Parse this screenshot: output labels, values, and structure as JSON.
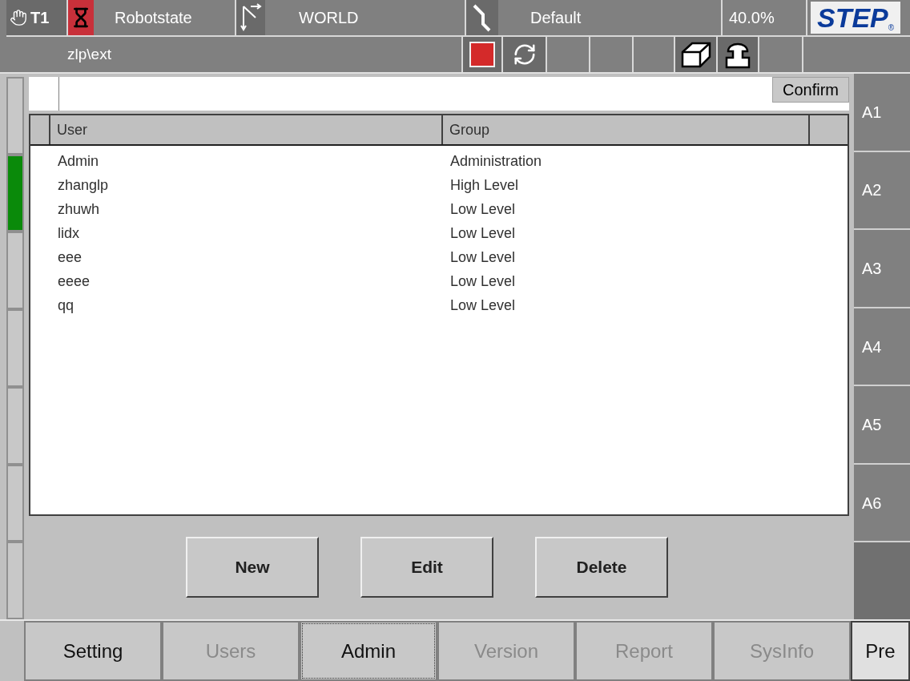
{
  "status_bar": {
    "mode": "T1",
    "robot_state": "Robotstate",
    "coordinate": "WORLD",
    "tool": "Default",
    "speed": "40.0%",
    "logo": "STEP",
    "logo_mark": "®",
    "path": "zlp\\ext"
  },
  "command": {
    "button": "Confirm"
  },
  "left_keys": [
    {
      "selected": false
    },
    {
      "selected": true
    },
    {
      "selected": false
    },
    {
      "selected": false
    },
    {
      "selected": false
    },
    {
      "selected": false
    },
    {
      "selected": false
    }
  ],
  "table": {
    "columns": [
      "User",
      "Group"
    ],
    "rows": [
      [
        "Admin",
        "Administration"
      ],
      [
        "zhanglp",
        "High Level"
      ],
      [
        "zhuwh",
        "Low Level"
      ],
      [
        "lidx",
        "Low Level"
      ],
      [
        "eee",
        "Low Level"
      ],
      [
        "eeee",
        "Low Level"
      ],
      [
        "qq",
        "Low Level"
      ]
    ]
  },
  "buttons": [
    "New",
    "Edit",
    "Delete"
  ],
  "axis_keys": [
    "A1",
    "A2",
    "A3",
    "A4",
    "A5",
    "A6"
  ],
  "tabs": [
    {
      "label": "Setting",
      "selected": false,
      "disabled": false
    },
    {
      "label": "Users",
      "selected": false,
      "disabled": true
    },
    {
      "label": "Admin",
      "selected": true,
      "disabled": false
    },
    {
      "label": "Version",
      "selected": false,
      "disabled": true
    },
    {
      "label": "Report",
      "selected": false,
      "disabled": true
    },
    {
      "label": "SysInfo",
      "selected": false,
      "disabled": true
    }
  ],
  "page_button": "Pre"
}
